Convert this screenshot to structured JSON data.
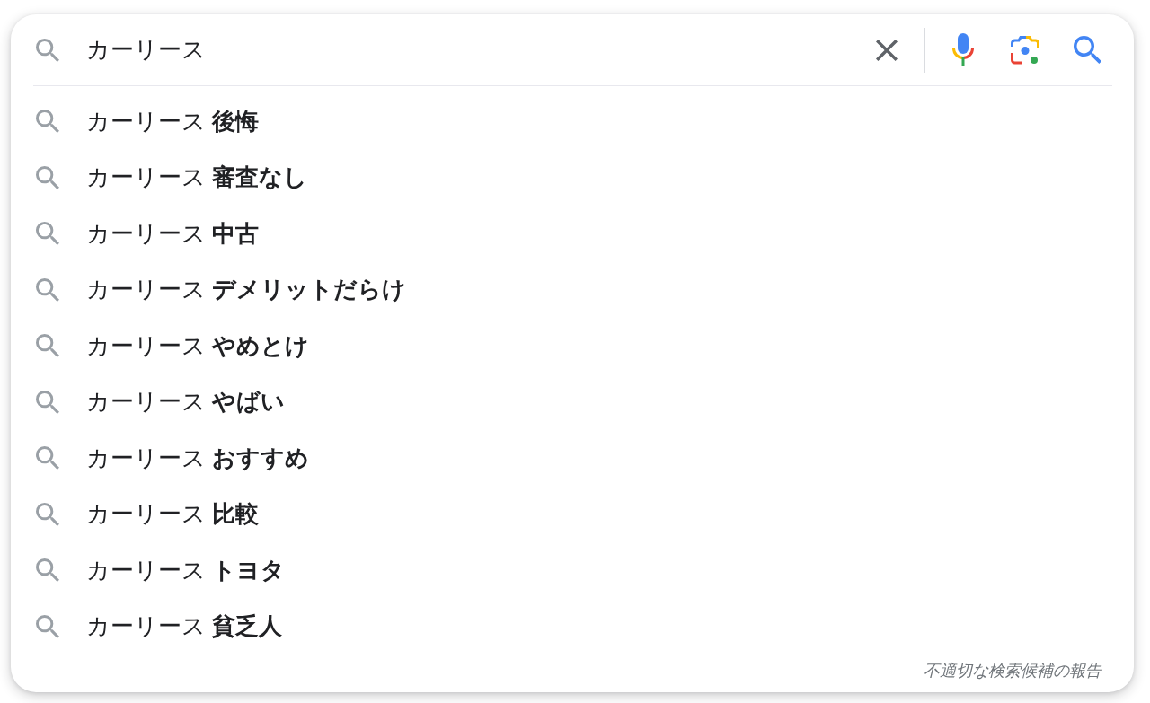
{
  "search_bar": {
    "query": "カーリース"
  },
  "suggestions": [
    {
      "text": "カーリース **後悔**"
    },
    {
      "text": "カーリース **審査なし**"
    },
    {
      "text": "カーリース **中古**"
    },
    {
      "text": "カーリース **デメリットだらけ**"
    },
    {
      "text": "カーリース **やめとけ**"
    },
    {
      "text": "カーリース **やばい**"
    },
    {
      "text": "カーリース **おすすめ**"
    },
    {
      "text": "カーリース **比較**"
    },
    {
      "text": "カーリース **トヨタ**"
    },
    {
      "text": "カーリース **貧乏人**"
    }
  ],
  "footer": {
    "report_link": "不適切な検索候補の報告"
  }
}
